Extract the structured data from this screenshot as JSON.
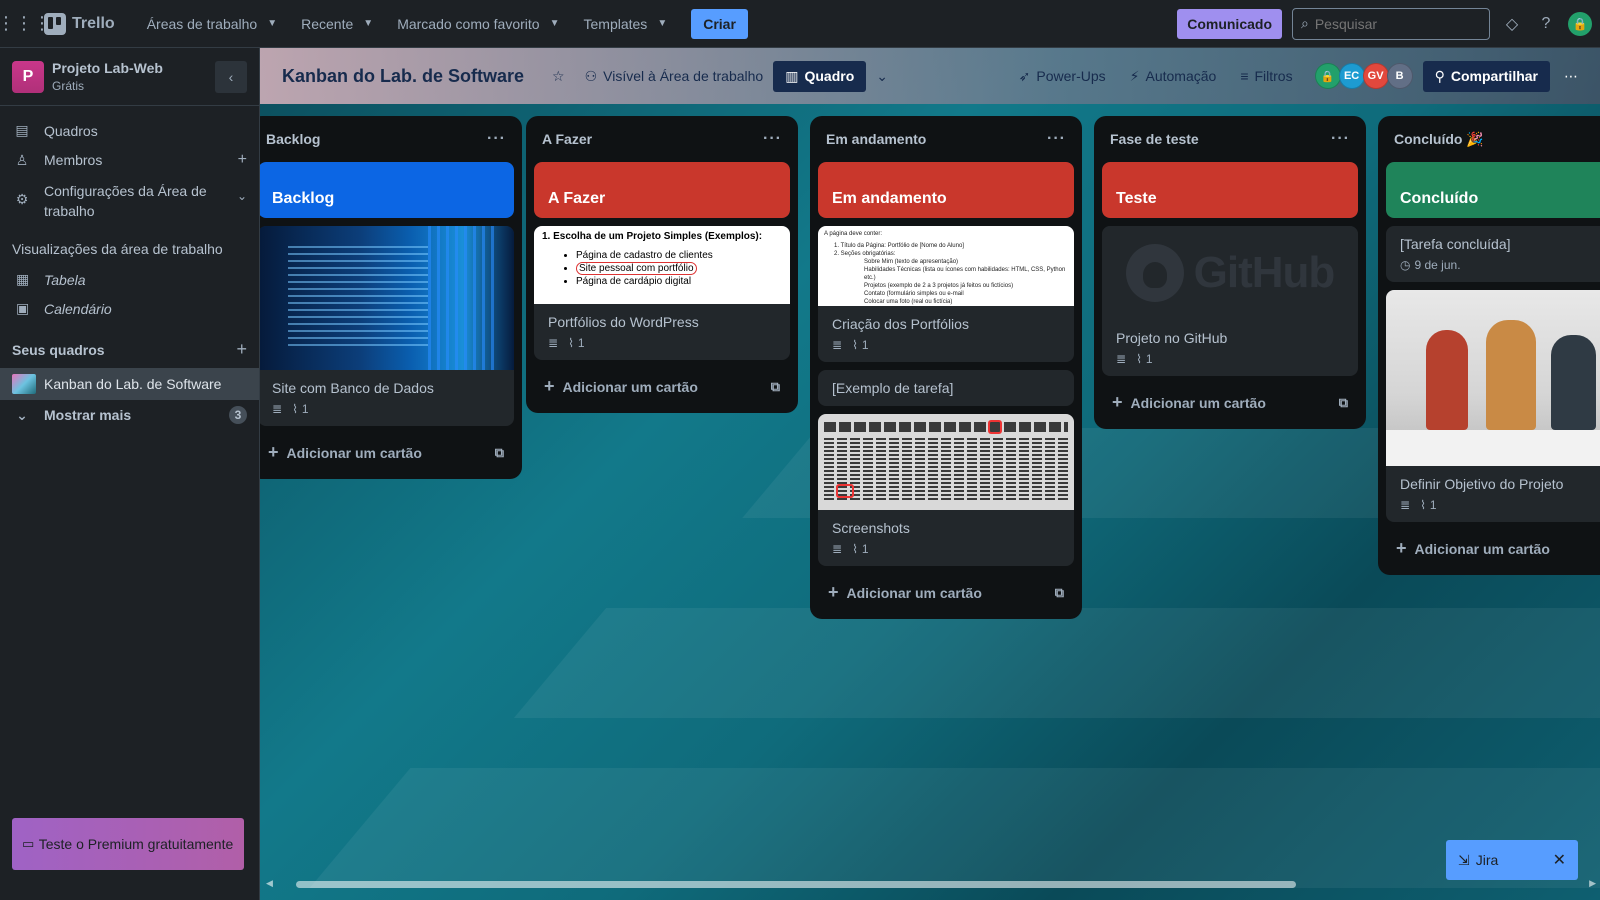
{
  "topbar": {
    "app_name": "Trello",
    "menus": [
      {
        "label": "Áreas de trabalho"
      },
      {
        "label": "Recente"
      },
      {
        "label": "Marcado como favorito"
      },
      {
        "label": "Templates"
      }
    ],
    "create_label": "Criar",
    "announce_label": "Comunicado",
    "search_placeholder": "Pesquisar"
  },
  "sidebar": {
    "workspace_name": "Projeto Lab-Web",
    "workspace_letter": "P",
    "workspace_plan": "Grátis",
    "items": [
      {
        "label": "Quadros"
      },
      {
        "label": "Membros"
      },
      {
        "label": "Configurações da Área de trabalho"
      }
    ],
    "views_title": "Visualizações da área de trabalho",
    "views": [
      {
        "label": "Tabela"
      },
      {
        "label": "Calendário"
      }
    ],
    "boards_title": "Seus quadros",
    "board_name": "Kanban do Lab. de Software",
    "show_more": "Mostrar mais",
    "show_more_count": "3",
    "premium_label": "Teste o Premium gratuitamente"
  },
  "board": {
    "title": "Kanban do Lab. de Software",
    "visibility": "Visível à Área de trabalho",
    "view_label": "Quadro",
    "powerups": "Power-Ups",
    "automation": "Automação",
    "filters": "Filtros",
    "avatars": [
      {
        "initials": "",
        "color": "#22a06b"
      },
      {
        "initials": "EC",
        "color": "#1d9bd1"
      },
      {
        "initials": "GV",
        "color": "#e2483d"
      },
      {
        "initials": "B",
        "color": "#626f86"
      }
    ],
    "share_label": "Compartilhar"
  },
  "lists": [
    {
      "title": "Backlog",
      "banner": "Backlog",
      "banner_color": "#0c66e4",
      "cards": [
        {
          "title": "Site com Banco de Dados",
          "attachments": "1"
        }
      ],
      "add_label": "Adicionar um cartão"
    },
    {
      "title": "A Fazer",
      "banner": "A Fazer",
      "banner_color": "#c9372c",
      "cards": [
        {
          "title": "Portfólios do WordPress",
          "attachments": "1"
        }
      ],
      "cover_doc": {
        "heading": "1. Escolha de um Projeto Simples (Exemplos):",
        "items": [
          "Página de cadastro de clientes",
          "Site pessoal com portfólio",
          "Página de cardápio digital"
        ]
      },
      "add_label": "Adicionar um cartão"
    },
    {
      "title": "Em andamento",
      "banner": "Em andamento",
      "banner_color": "#c9372c",
      "cards": [
        {
          "title": "Criação dos Portfólios",
          "attachments": "1"
        },
        {
          "title": "[Exemplo de tarefa]"
        },
        {
          "title": "Screenshots",
          "attachments": "1"
        }
      ],
      "cover_doc": {
        "intro": "A página deve conter:",
        "lines": [
          "1. Título da Página: Portfólio de [Nome do Aluno]",
          "2. Seções obrigatórias:",
          "Sobre Mim (texto de apresentação)",
          "Habilidades Técnicas (lista ou ícones com habilidades: HTML, CSS, Python etc.)",
          "Projetos (exemplo de 2 a 3 projetos já feitos ou fictícios)",
          "Contato (formulário simples ou e-mail",
          "Colocar uma foto (real ou fictícia)"
        ]
      },
      "add_label": "Adicionar um cartão"
    },
    {
      "title": "Fase de teste",
      "banner": "Teste",
      "banner_color": "#c9372c",
      "cards": [
        {
          "title": "Projeto no GitHub",
          "attachments": "1"
        }
      ],
      "cover_text": "GitHub",
      "add_label": "Adicionar um cartão"
    },
    {
      "title": "Concluído 🎉",
      "banner": "Concluído",
      "banner_color": "#1f845a",
      "cards": [
        {
          "title": "[Tarefa concluída]",
          "date": "9 de jun."
        },
        {
          "title": "Definir Objetivo do Projeto",
          "attachments": "1"
        }
      ],
      "add_label": "Adicionar um cartão"
    }
  ],
  "jira": {
    "label": "Jira"
  }
}
